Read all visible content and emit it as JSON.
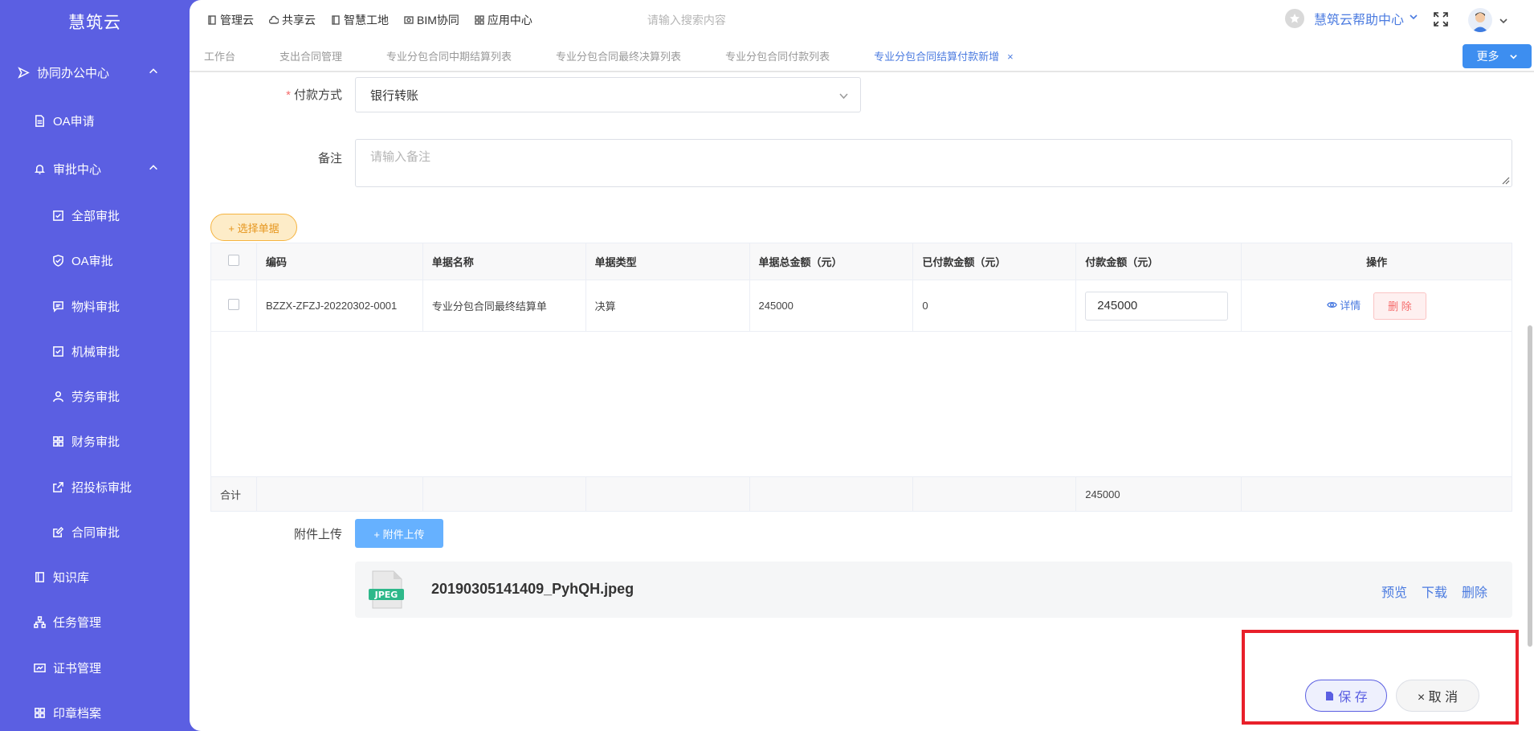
{
  "sidebar": {
    "logo": "慧筑云",
    "items": [
      {
        "label": "协同办公中心",
        "icon": "send-icon"
      },
      {
        "label": "OA申请",
        "icon": "document-icon"
      },
      {
        "label": "审批中心",
        "icon": "bell-icon"
      },
      {
        "label": "全部审批",
        "icon": "check-square-icon"
      },
      {
        "label": "OA审批",
        "icon": "shield-check-icon"
      },
      {
        "label": "物料审批",
        "icon": "message-icon"
      },
      {
        "label": "机械审批",
        "icon": "check-square-icon"
      },
      {
        "label": "劳务审批",
        "icon": "user-icon"
      },
      {
        "label": "财务审批",
        "icon": "grid-icon"
      },
      {
        "label": "招投标审批",
        "icon": "external-icon"
      },
      {
        "label": "合同审批",
        "icon": "edit-icon"
      },
      {
        "label": "知识库",
        "icon": "book-icon"
      },
      {
        "label": "任务管理",
        "icon": "sitemap-icon"
      },
      {
        "label": "证书管理",
        "icon": "card-icon"
      },
      {
        "label": "印章档案",
        "icon": "grid-icon"
      }
    ]
  },
  "topbar": {
    "links": [
      "管理云",
      "共享云",
      "智慧工地",
      "BIM协同",
      "应用中心"
    ],
    "search_placeholder": "请输入搜索内容",
    "help_label": "慧筑云帮助中心"
  },
  "tabs": {
    "items": [
      "工作台",
      "支出合同管理",
      "专业分包合同中期结算列表",
      "专业分包合同最终决算列表",
      "专业分包合同付款列表",
      "专业分包合同结算付款新增"
    ],
    "close": "×",
    "more_label": "更多"
  },
  "form": {
    "payment_method_label": "付款方式",
    "payment_method_value": "银行转账",
    "remark_label": "备注",
    "remark_placeholder": "请输入备注",
    "select_doc_label": "+ 选择单据"
  },
  "table": {
    "headers": [
      "编码",
      "单据名称",
      "单据类型",
      "单据总金额（元）",
      "已付款金额（元）",
      "付款金额（元）",
      "操作"
    ],
    "rows": [
      {
        "code": "BZZX-ZFZJ-20220302-0001",
        "name": "专业分包合同最终结算单",
        "type": "决算",
        "total": "245000",
        "paid": "0",
        "amount": "245000"
      }
    ],
    "detail_label": "详情",
    "delete_label": "删 除",
    "sum_label": "合计",
    "sum_amount": "245000"
  },
  "attachment": {
    "label": "附件上传",
    "upload_label": "+ 附件上传",
    "file_name": "20190305141409_PyhQH.jpeg",
    "file_type": "JPEG",
    "preview": "预览",
    "download": "下载",
    "delete": "删除"
  },
  "footer": {
    "save_label": "保 存",
    "cancel_label": "× 取 消"
  },
  "colors": {
    "sidebar": "#5b5fe2",
    "accent": "#4b7be0",
    "highlight": "#e8202a"
  }
}
